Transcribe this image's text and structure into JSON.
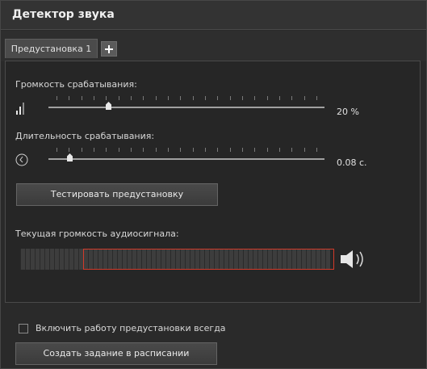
{
  "header": {
    "title": "Детектор звука"
  },
  "tabs": {
    "items": [
      {
        "label": "Предустановка 1"
      }
    ]
  },
  "volume": {
    "label": "Громкость срабатывания:",
    "value": "20 %",
    "level": 0.2
  },
  "duration": {
    "label": "Длительность срабатывания:",
    "value": "0.08 с.",
    "level": 0.05
  },
  "test_button": {
    "label": "Тестировать предустановку"
  },
  "audio": {
    "label": "Текущая громкость аудиосигнала:",
    "peak_start": 0.2
  },
  "footer": {
    "always_enable_label": "Включить работу предустановки всегда",
    "always_enable_checked": false,
    "schedule_button": "Создать задание в расписании"
  },
  "icons": {
    "volume": "volume-bars-icon",
    "duration": "clock-icon",
    "speaker": "speaker-icon",
    "add": "plus-icon"
  },
  "colors": {
    "peak_border": "#d23a2a"
  }
}
